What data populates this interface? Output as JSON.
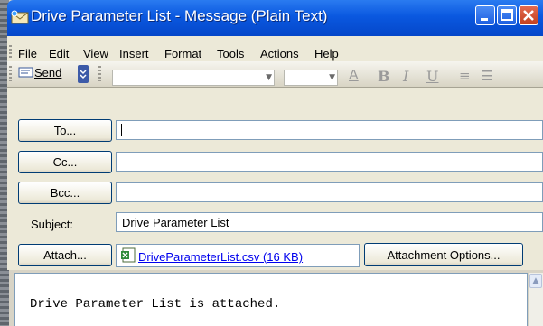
{
  "window": {
    "title": "Drive Parameter List - Message (Plain Text)"
  },
  "menu": {
    "items": [
      "File",
      "Edit",
      "View",
      "Insert",
      "Format",
      "Tools",
      "Actions",
      "Help"
    ]
  },
  "toolbar": {
    "send_label": "Send",
    "font_value": "",
    "size_value": "",
    "format_buttons": [
      "font-color",
      "bold",
      "italic",
      "underline",
      "align",
      "bullets"
    ]
  },
  "form": {
    "to_label": "To...",
    "cc_label": "Cc...",
    "bcc_label": "Bcc...",
    "to_value": "",
    "cc_value": "",
    "bcc_value": "",
    "subject_label": "Subject:",
    "subject_value": "Drive Parameter List",
    "attach_label": "Attach...",
    "attachment_file": "DriveParameterList.csv (16 KB)",
    "attachment_options_label": "Attachment Options..."
  },
  "message": {
    "body": "Drive Parameter List is attached."
  }
}
